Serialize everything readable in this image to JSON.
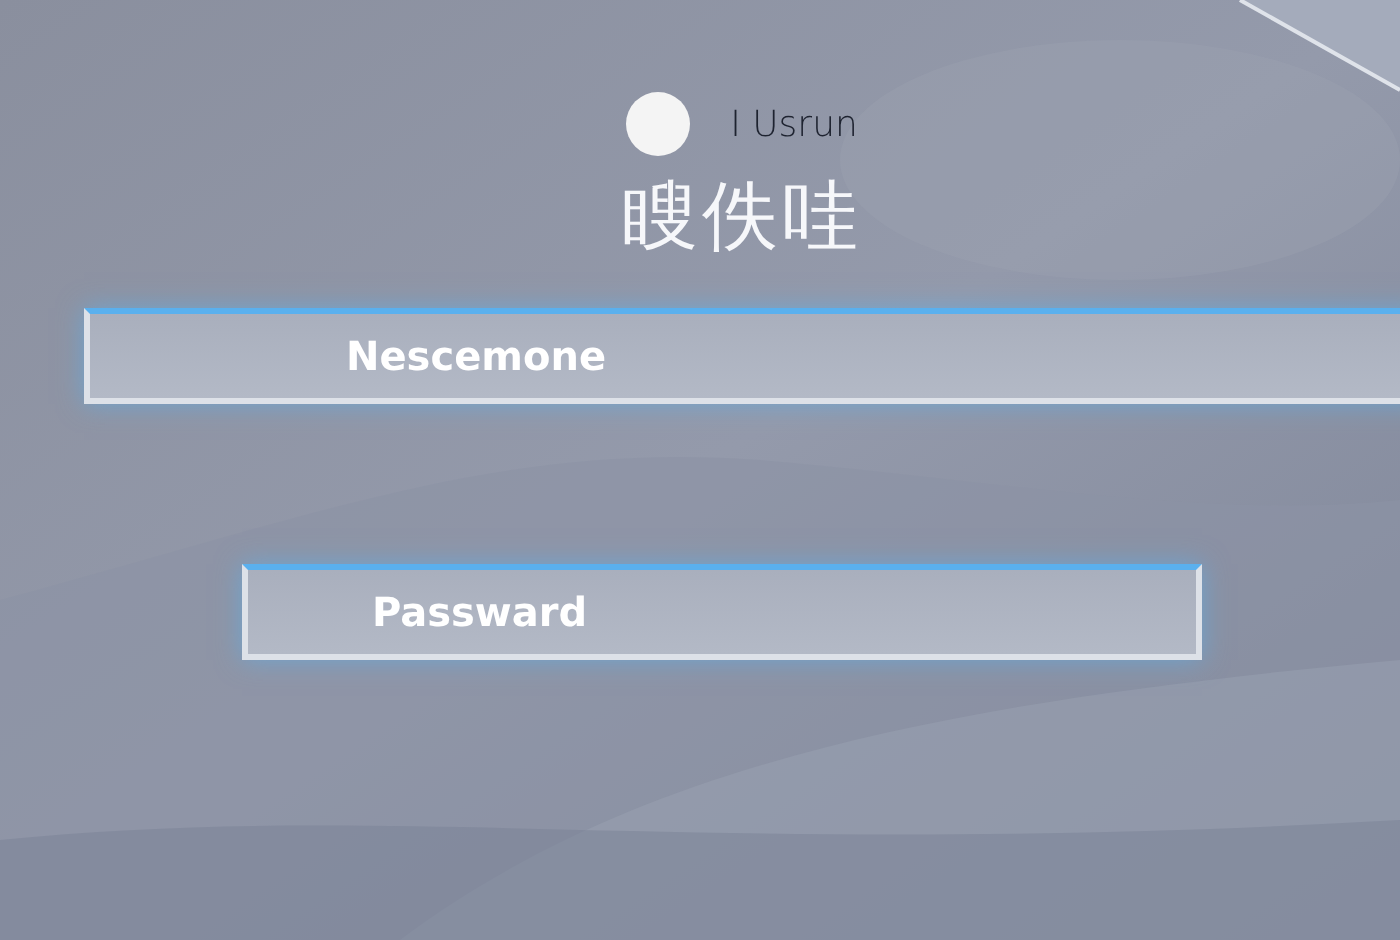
{
  "header": {
    "label": "I Usrun",
    "title": "瞍佚哇"
  },
  "fields": [
    {
      "kind": "username",
      "placeholder": "Nescemone"
    },
    {
      "kind": "password",
      "placeholder": "Passward"
    }
  ]
}
